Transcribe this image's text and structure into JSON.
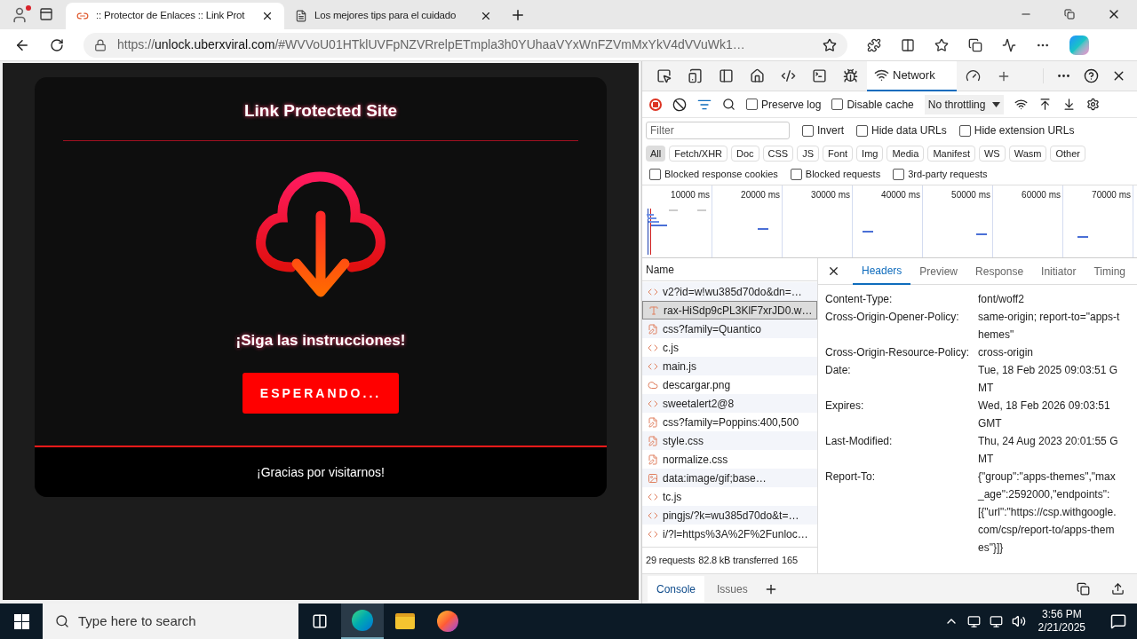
{
  "browser": {
    "tabs": [
      {
        "title": ":: Protector de Enlaces :: Link Prot",
        "selected": true
      },
      {
        "title": "Los mejores tips para el cuidado",
        "selected": false
      }
    ],
    "url": {
      "scheme": "https://",
      "host": "unlock.uberxviral.com",
      "path": "/#WVVoU01HTklUVFpNZVRrelpETmpla3h0YUhaaVYxWnFZVmMxYkV4dVVuWk1…"
    }
  },
  "page": {
    "title": "Link Protected Site",
    "message": "¡Siga las instrucciones!",
    "button": "ESPERANDO...",
    "footer": "¡Gracias por visitarnos!"
  },
  "devtools": {
    "tools": [
      {
        "kind": "inspect",
        "selected": false
      },
      {
        "kind": "device",
        "selected": false
      },
      {
        "kind": "dock",
        "selected": false
      },
      {
        "kind": "home",
        "selected": false
      },
      {
        "kind": "elements",
        "selected": false
      },
      {
        "kind": "console",
        "selected": false
      },
      {
        "kind": "sources",
        "selected": false
      },
      {
        "kind": "network",
        "label": "Network",
        "selected": true
      },
      {
        "kind": "performance",
        "selected": false
      }
    ],
    "toolbar": {
      "preserve_log": {
        "label": "Preserve log",
        "checked": false
      },
      "disable_cache": {
        "label": "Disable cache",
        "checked": false
      },
      "throttling": "No throttling"
    },
    "filter": {
      "placeholder": "Filter",
      "options": [
        {
          "label": "Invert",
          "checked": false
        },
        {
          "label": "Hide data URLs",
          "checked": false
        },
        {
          "label": "Hide extension URLs",
          "checked": false
        }
      ]
    },
    "types": [
      {
        "label": "All",
        "selected": true
      },
      {
        "label": "Fetch/XHR",
        "selected": false
      },
      {
        "label": "Doc",
        "selected": false
      },
      {
        "label": "CSS",
        "selected": false
      },
      {
        "label": "JS",
        "selected": false
      },
      {
        "label": "Font",
        "selected": false
      },
      {
        "label": "Img",
        "selected": false
      },
      {
        "label": "Media",
        "selected": false
      },
      {
        "label": "Manifest",
        "selected": false
      },
      {
        "label": "WS",
        "selected": false
      },
      {
        "label": "Wasm",
        "selected": false
      },
      {
        "label": "Other",
        "selected": false
      }
    ],
    "blocked": [
      {
        "label": "Blocked response cookies",
        "checked": false
      },
      {
        "label": "Blocked requests",
        "checked": false
      },
      {
        "label": "3rd-party requests",
        "checked": false
      }
    ],
    "timeline_ticks": [
      "10000 ms",
      "20000 ms",
      "30000 ms",
      "40000 ms",
      "50000 ms",
      "60000 ms",
      "70000 ms"
    ],
    "list_heading": "Name",
    "requests": [
      {
        "name": "v2?id=w!wu385d70do&dn=…",
        "kind": "script",
        "selected": false
      },
      {
        "name": "rax-HiSdp9cPL3KlF7xrJD0.w…",
        "kind": "font",
        "selected": true
      },
      {
        "name": "css?family=Quantico",
        "kind": "style",
        "selected": false
      },
      {
        "name": "c.js",
        "kind": "script",
        "selected": false
      },
      {
        "name": "main.js",
        "kind": "script",
        "selected": false
      },
      {
        "name": "descargar.png",
        "kind": "image",
        "selected": false
      },
      {
        "name": "sweetalert2@8",
        "kind": "script",
        "selected": false
      },
      {
        "name": "css?family=Poppins:400,500",
        "kind": "style",
        "selected": false
      },
      {
        "name": "style.css",
        "kind": "style",
        "selected": false
      },
      {
        "name": "normalize.css",
        "kind": "style",
        "selected": false
      },
      {
        "name": "data:image/gif;base…",
        "kind": "data",
        "selected": false
      },
      {
        "name": "tc.js",
        "kind": "script",
        "selected": false
      },
      {
        "name": "pingjs/?k=wu385d70do&t=…",
        "kind": "script",
        "selected": false
      },
      {
        "name": "i/?l=https%3A%2F%2Funloc…",
        "kind": "script",
        "selected": false
      }
    ],
    "summary": [
      "29 requests",
      "82.8 kB transferred",
      "165"
    ],
    "detail_tabs": [
      {
        "label": "Headers",
        "selected": true
      },
      {
        "label": "Preview",
        "selected": false
      },
      {
        "label": "Response",
        "selected": false
      },
      {
        "label": "Initiator",
        "selected": false
      },
      {
        "label": "Timing",
        "selected": false
      }
    ],
    "headers": [
      {
        "name": "Content-Type:",
        "value": "font/woff2"
      },
      {
        "name": "Cross-Origin-Opener-Policy:",
        "value": "same-origin; report-to=\"apps-themes\""
      },
      {
        "name": "Cross-Origin-Resource-Policy:",
        "value": "cross-origin"
      },
      {
        "name": "Date:",
        "value": "Tue, 18 Feb 2025 09:03:51 GMT"
      },
      {
        "name": "Expires:",
        "value": "Wed, 18 Feb 2026 09:03:51 GMT"
      },
      {
        "name": "Last-Modified:",
        "value": "Thu, 24 Aug 2023 20:01:55 GMT"
      },
      {
        "name": "Report-To:",
        "value": "{\"group\":\"apps-themes\",\"max_age\":2592000,\"endpoints\":[{\"url\":\"https://csp.withgoogle.com/csp/report-to/apps-themes\"}]}"
      }
    ],
    "drawer_tabs": [
      {
        "label": "Console",
        "selected": true
      },
      {
        "label": "Issues",
        "selected": false
      }
    ]
  },
  "taskbar": {
    "search_placeholder": "Type here to search",
    "time": "3:56 PM",
    "date": "2/21/2025"
  }
}
